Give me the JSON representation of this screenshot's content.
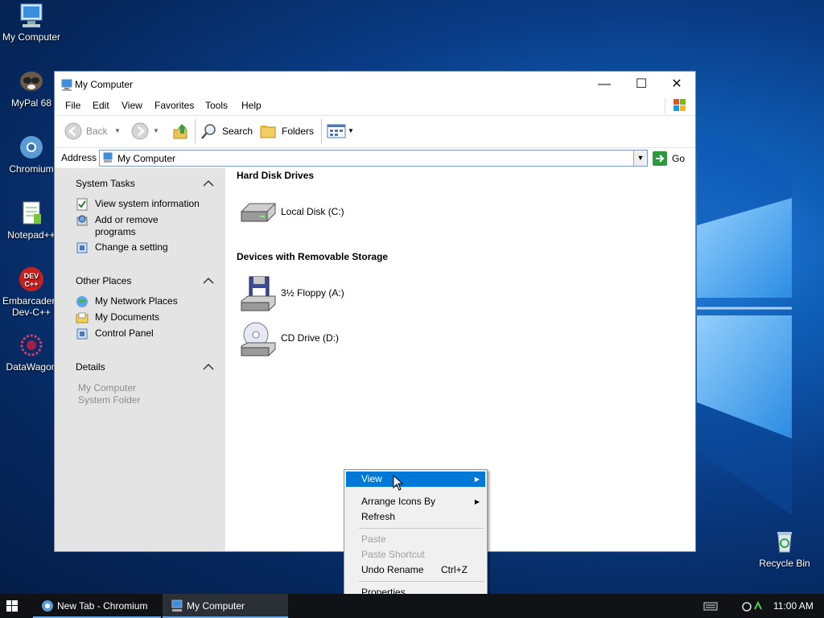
{
  "desktop": {
    "icons": [
      {
        "label": "My Computer"
      },
      {
        "label": "MyPal 68"
      },
      {
        "label": "Chromium"
      },
      {
        "label": "Notepad++"
      },
      {
        "label": "Embarcadero Dev-C++"
      },
      {
        "label": "DataWagon"
      },
      {
        "label": "Recycle Bin"
      }
    ]
  },
  "window": {
    "title": "My Computer",
    "controls": {
      "minimize": "—",
      "maximize": "☐",
      "close": "✕"
    },
    "menu": [
      "File",
      "Edit",
      "View",
      "Favorites",
      "Tools",
      "Help"
    ],
    "toolbar": {
      "back_label": "Back",
      "search_label": "Search",
      "folders_label": "Folders"
    },
    "address": {
      "label": "Address",
      "value": "My Computer",
      "go_label": "Go"
    },
    "taskpane": {
      "system_tasks": {
        "title": "System Tasks",
        "items": [
          "View system information",
          "Add or remove programs",
          "Change a setting"
        ]
      },
      "other_places": {
        "title": "Other Places",
        "items": [
          "My Network Places",
          "My Documents",
          "Control Panel"
        ]
      },
      "details": {
        "title": "Details",
        "name": "My Computer",
        "type": "System Folder"
      }
    },
    "content": {
      "groups": [
        {
          "title": "Hard Disk Drives",
          "items": [
            "Local Disk (C:)"
          ]
        },
        {
          "title": "Devices with Removable Storage",
          "items": [
            "3½ Floppy (A:)",
            "CD Drive (D:)"
          ]
        }
      ]
    }
  },
  "context_menu": {
    "items": [
      {
        "label": "View",
        "submenu": true,
        "state": "highlighted"
      },
      {
        "label": "Arrange Icons By",
        "submenu": true,
        "state": "normal"
      },
      {
        "label": "Refresh",
        "state": "normal"
      },
      {
        "label": "Paste",
        "state": "disabled"
      },
      {
        "label": "Paste Shortcut",
        "state": "disabled"
      },
      {
        "label": "Undo Rename",
        "shortcut": "Ctrl+Z",
        "state": "normal"
      },
      {
        "label": "Properties",
        "state": "normal"
      }
    ]
  },
  "taskbar": {
    "buttons": [
      {
        "label": "New Tab - Chromium"
      },
      {
        "label": "My Computer",
        "active": true
      }
    ],
    "clock": "11:00 AM"
  },
  "colors": {
    "accent": "#0078d7",
    "taskpane_bg": "#e4e4e4",
    "taskbar_bg": "#101216"
  }
}
